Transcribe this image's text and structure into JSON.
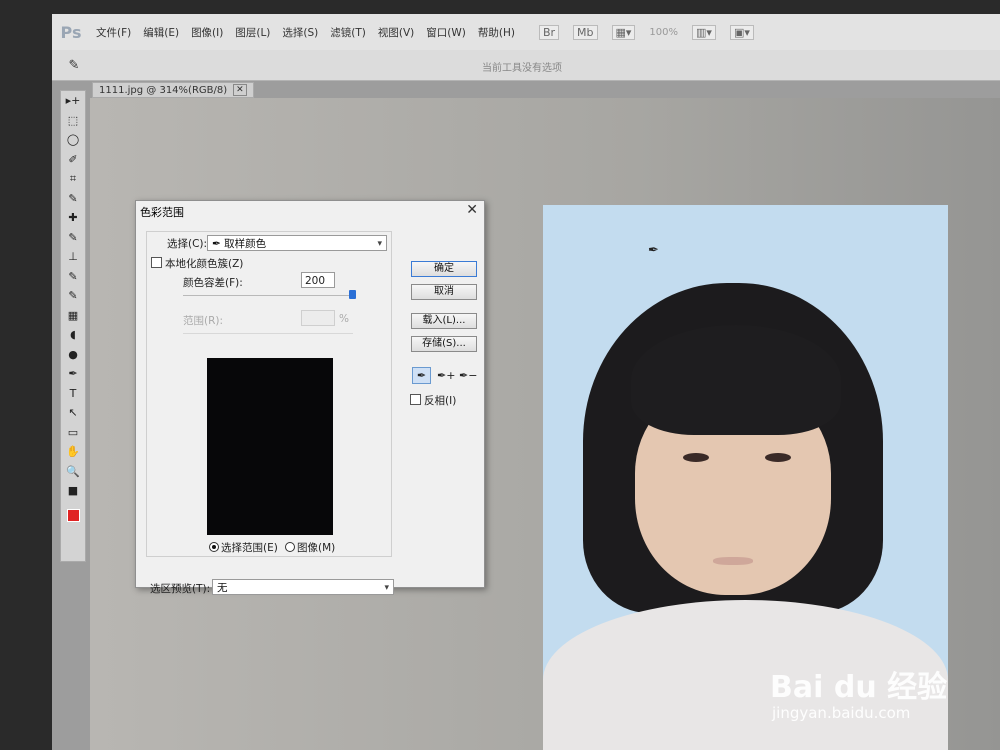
{
  "app": {
    "logo": "Ps"
  },
  "menu": [
    "文件(F)",
    "编辑(E)",
    "图像(I)",
    "图层(L)",
    "选择(S)",
    "滤镜(T)",
    "视图(V)",
    "窗口(W)",
    "帮助(H)"
  ],
  "menubar_icons": [
    "Br",
    "Mb"
  ],
  "zoom_readout": "100%",
  "options_bar": {
    "tool_icon": "✎",
    "hint": "当前工具没有选项"
  },
  "document_tab": {
    "label": "1111.jpg @ 314%(RGB/8)",
    "close": "✕"
  },
  "toolbox": [
    "▸+",
    "⬚",
    "◯",
    "✐",
    "⌗",
    "✎",
    "✚",
    "✎",
    "⊥",
    "✎",
    "✎",
    "▦",
    "◖",
    "●",
    "✒",
    "T",
    "↖",
    "▭",
    "✋",
    "🔍",
    "■"
  ],
  "colors": {
    "foreground": "#e02323",
    "background": "#2150d8",
    "accent": "#3a7bd5"
  },
  "dialog": {
    "title": "色彩范围",
    "close": "✕",
    "select_label": "选择(C):",
    "select_value": "取样颜色",
    "select_icon": "✒",
    "localized_label": "本地化颜色簇(Z)",
    "localized_checked": false,
    "fuzziness_label": "颜色容差(F):",
    "fuzziness_value": "200",
    "fuzziness_fraction": 1.0,
    "range_label": "范围(R):",
    "range_unit": "%",
    "radio_selection": "选择范围(E)",
    "radio_image": "图像(M)",
    "selection_preview_label": "选区预览(T):",
    "selection_preview_value": "无",
    "buttons": {
      "ok": "确定",
      "cancel": "取消",
      "load": "载入(L)...",
      "save": "存储(S)..."
    },
    "eyedroppers": [
      "✒",
      "✒+",
      "✒−"
    ],
    "invert_label": "反相(I)",
    "invert_checked": false
  },
  "watermark": {
    "brand": "Bai du 经验",
    "url": "jingyan.baidu.com"
  }
}
